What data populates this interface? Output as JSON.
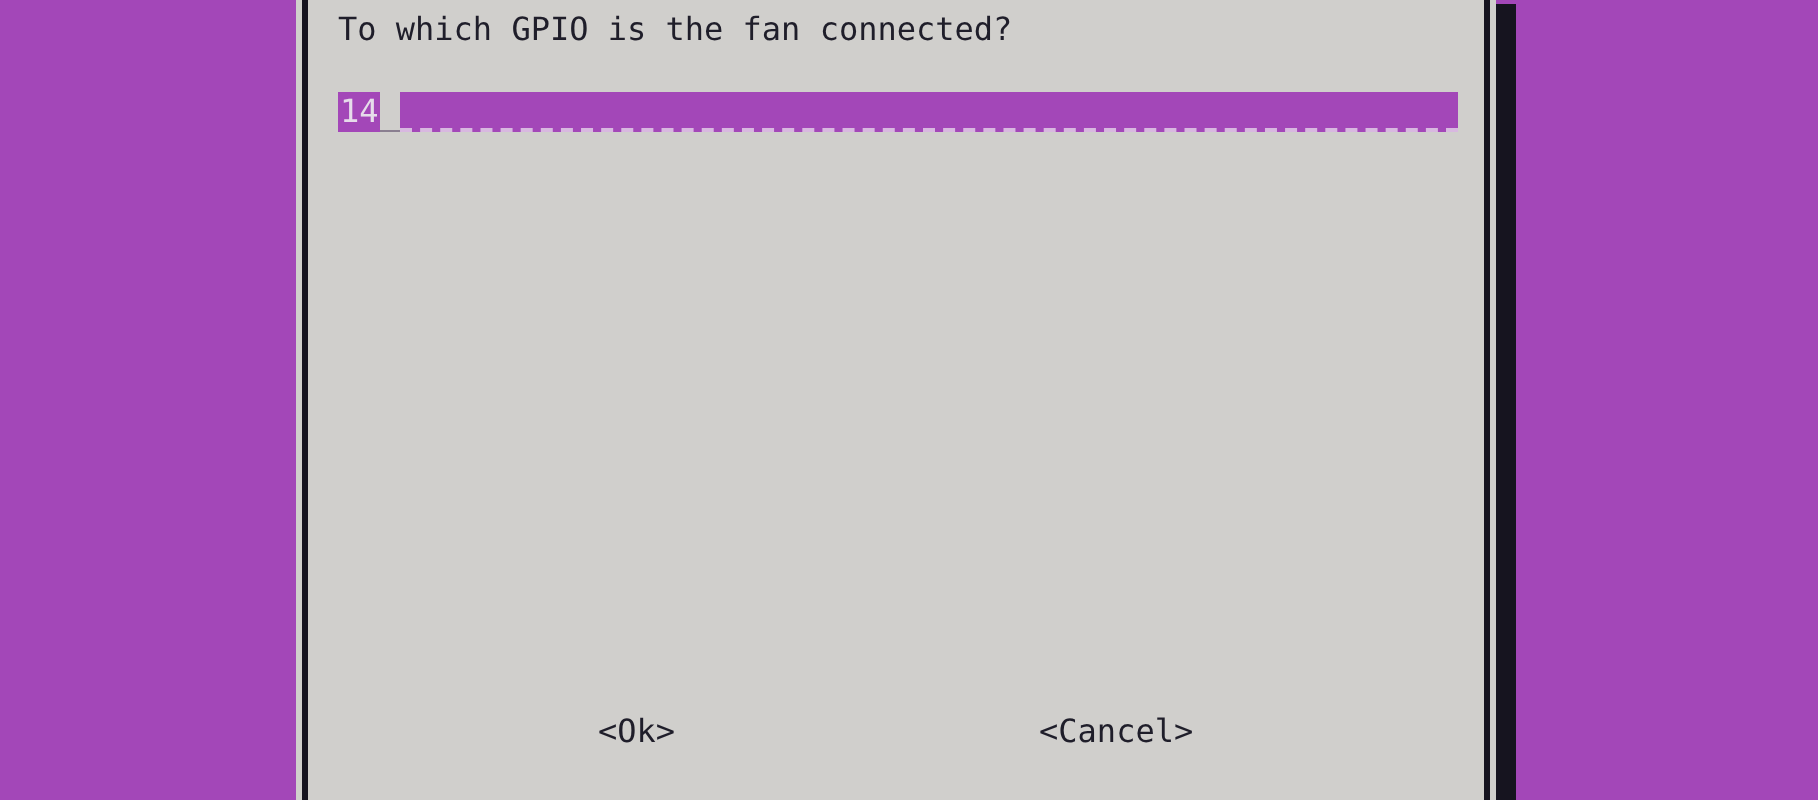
{
  "dialog": {
    "prompt": "To which GPIO is the fan connected?",
    "input": {
      "value": "14",
      "focused": true
    },
    "buttons": [
      {
        "label": "<Ok>",
        "selected": false
      },
      {
        "label": "<Cancel>",
        "selected": false
      }
    ]
  }
}
